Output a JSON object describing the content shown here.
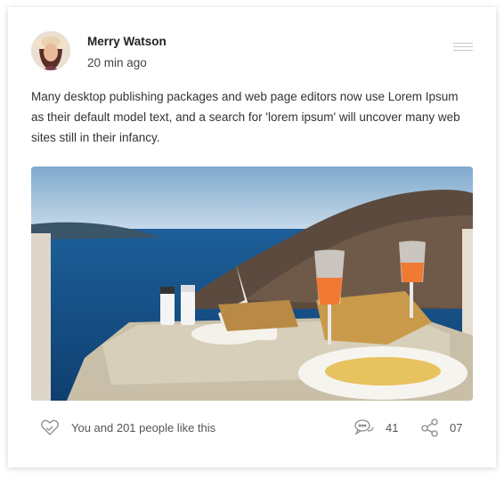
{
  "post": {
    "author_name": "Merry Watson",
    "time_ago": "20 min ago",
    "body_text": "Many desktop publishing packages and web page editors now use Lorem Ipsum as their default model text, and a search for 'lorem ipsum' will uncover many web sites still in their infancy.",
    "likes_text": "You and 201 people like this",
    "comments_count": "41",
    "shares_count": "07"
  },
  "icons": {
    "menu": "hamburger-menu-icon",
    "like": "heart-hand-icon",
    "comment": "speech-bubbles-icon",
    "share": "share-nodes-icon"
  },
  "colors": {
    "icon_gray": "#8a8a8a",
    "card_bg": "#ffffff"
  }
}
